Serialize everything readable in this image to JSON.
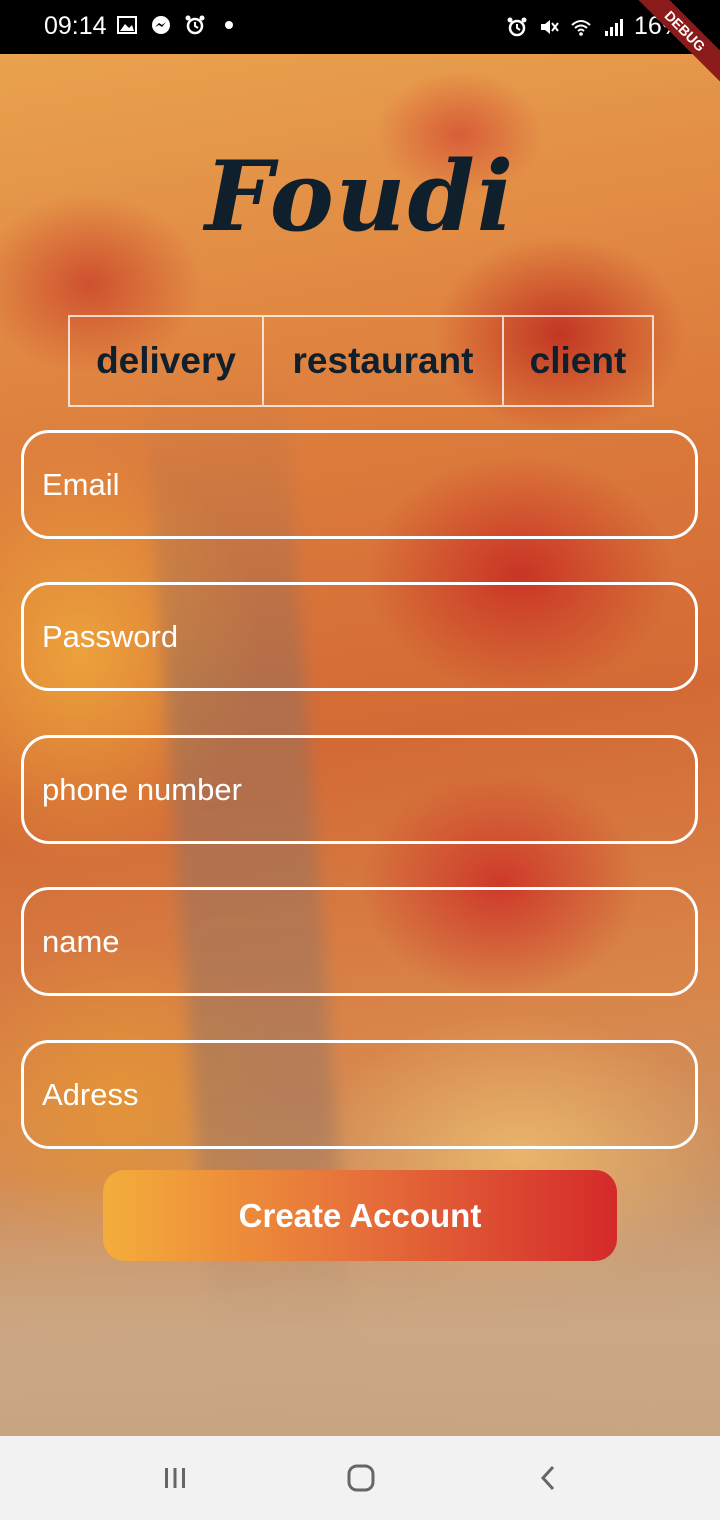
{
  "status_bar": {
    "time": "09:14",
    "battery": "16%",
    "left_icons": [
      "gallery-icon",
      "messenger-icon",
      "alarm-icon",
      "dot-icon"
    ],
    "right_icons": [
      "alarm-icon",
      "mute-icon",
      "wifi-icon",
      "signal-icon"
    ]
  },
  "debug_banner": "DEBUG",
  "app": {
    "logo": "Foudi",
    "role_tabs": [
      {
        "label": "delivery"
      },
      {
        "label": "restaurant"
      },
      {
        "label": "client"
      }
    ],
    "fields": {
      "email_placeholder": "Email",
      "password_placeholder": "Password",
      "phone_placeholder": "phone number",
      "name_placeholder": "name",
      "address_placeholder": "Adress"
    },
    "create_button": "Create Account"
  },
  "colors": {
    "logo": "#0f1f2c",
    "button_gradient_start": "#f4ad3b",
    "button_gradient_end": "#d42a2a",
    "field_border": "#ffffff"
  },
  "nav_bar": {
    "icons": [
      "recent-apps-icon",
      "home-icon",
      "back-icon"
    ]
  }
}
